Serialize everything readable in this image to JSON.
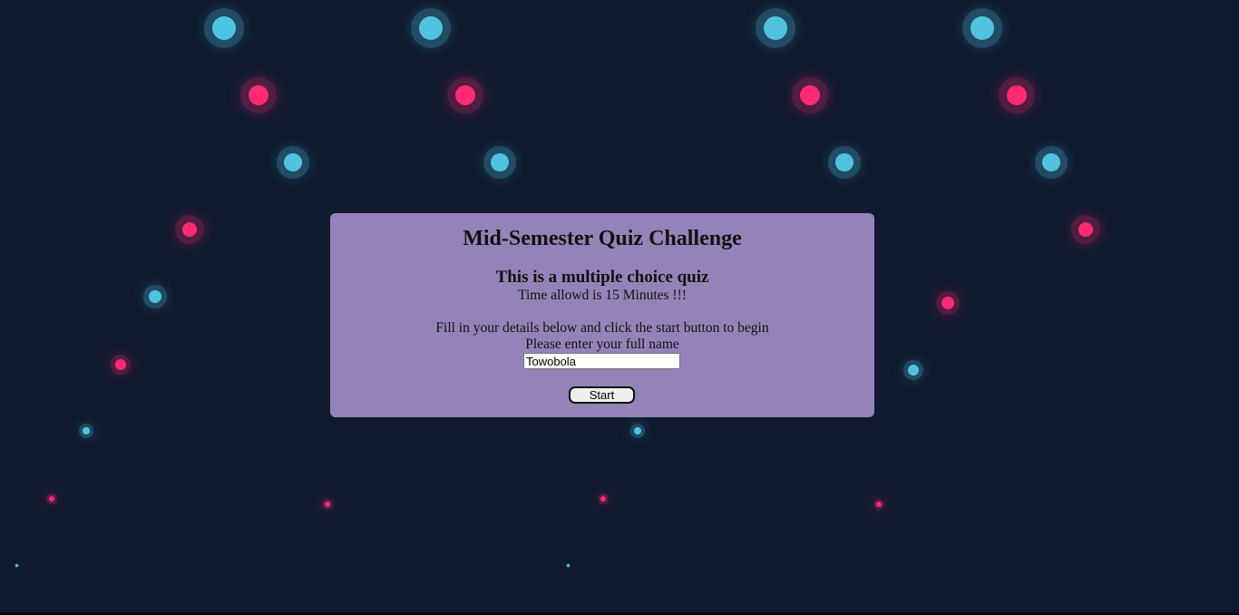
{
  "quiz": {
    "title": "Mid-Semester Quiz Challenge",
    "subtitle": "This is a multiple choice quiz",
    "time_note": "Time allowd is 15 Minutes !!!",
    "instructions": "Fill in your details below and click the start button to begin",
    "name_prompt": "Please enter your full name",
    "name_value": "Towobola",
    "start_label": "Start"
  },
  "colors": {
    "background": "#0f1a2e",
    "panel": "#9483b8",
    "dot_blue": "#4fc3e0",
    "dot_pink": "#ff2a72"
  }
}
